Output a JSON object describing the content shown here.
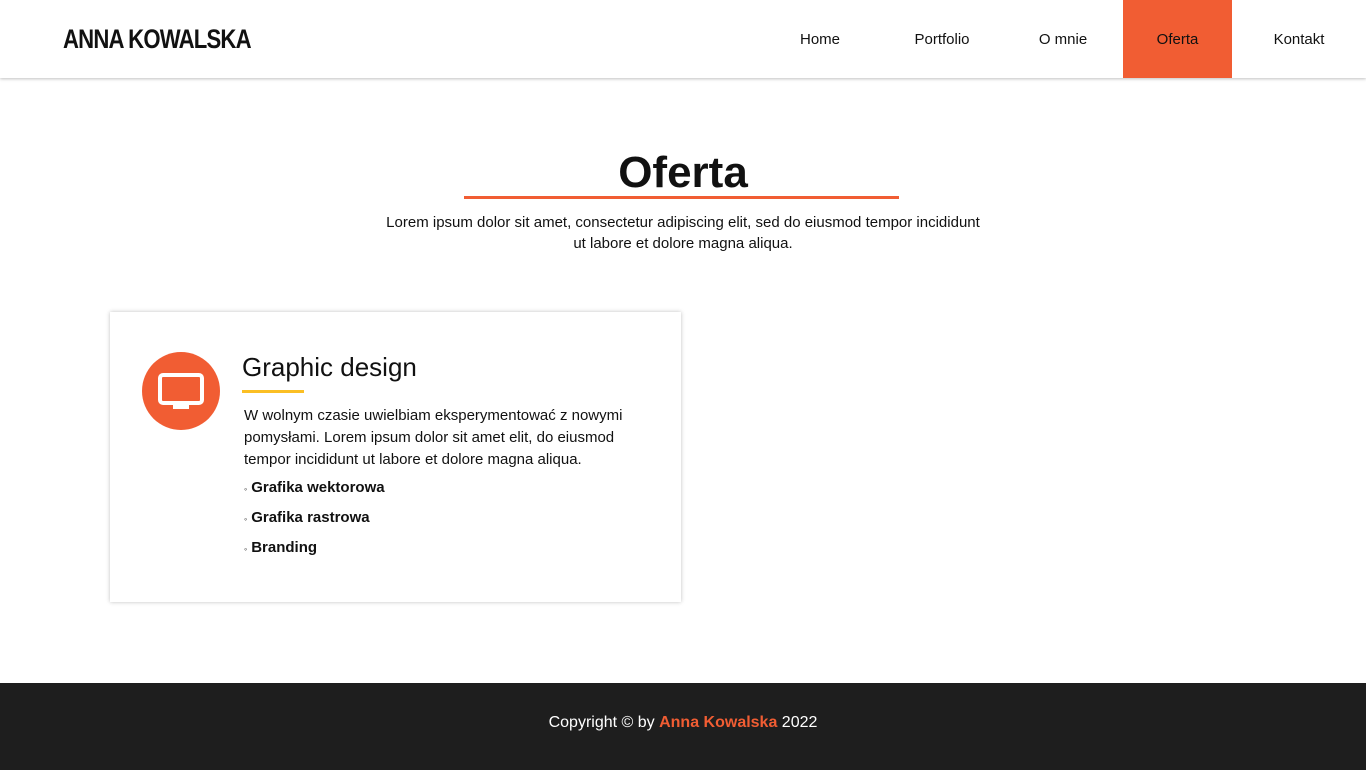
{
  "header": {
    "logo": "ANNA KOWALSKA",
    "nav": [
      {
        "label": "Home"
      },
      {
        "label": "Portfolio"
      },
      {
        "label": "O mnie"
      },
      {
        "label": "Oferta",
        "active": true
      },
      {
        "label": "Kontakt"
      }
    ]
  },
  "main": {
    "title": "Oferta",
    "lead": "Lorem ipsum dolor sit amet, consectetur adipiscing elit, sed do eiusmod tempor incididunt ut labore et dolore magna aliqua.",
    "card": {
      "icon": "monitor-icon",
      "title": "Graphic design",
      "text": "W wolnym czasie uwielbiam eksperymentować z nowymi pomysłami. Lorem ipsum dolor sit amet elit, do eiusmod tempor incididunt ut labore et dolore magna aliqua.",
      "items": [
        "Grafika wektorowa",
        "Grafika rastrowa",
        "Branding"
      ],
      "bullet": "◦"
    }
  },
  "footer": {
    "prefix": "Copyright © by ",
    "name": "Anna Kowalska",
    "suffix": " 2022"
  },
  "colors": {
    "accent": "#f15d33",
    "underline": "#fbbf24",
    "footer_bg": "#1e1e1e"
  }
}
